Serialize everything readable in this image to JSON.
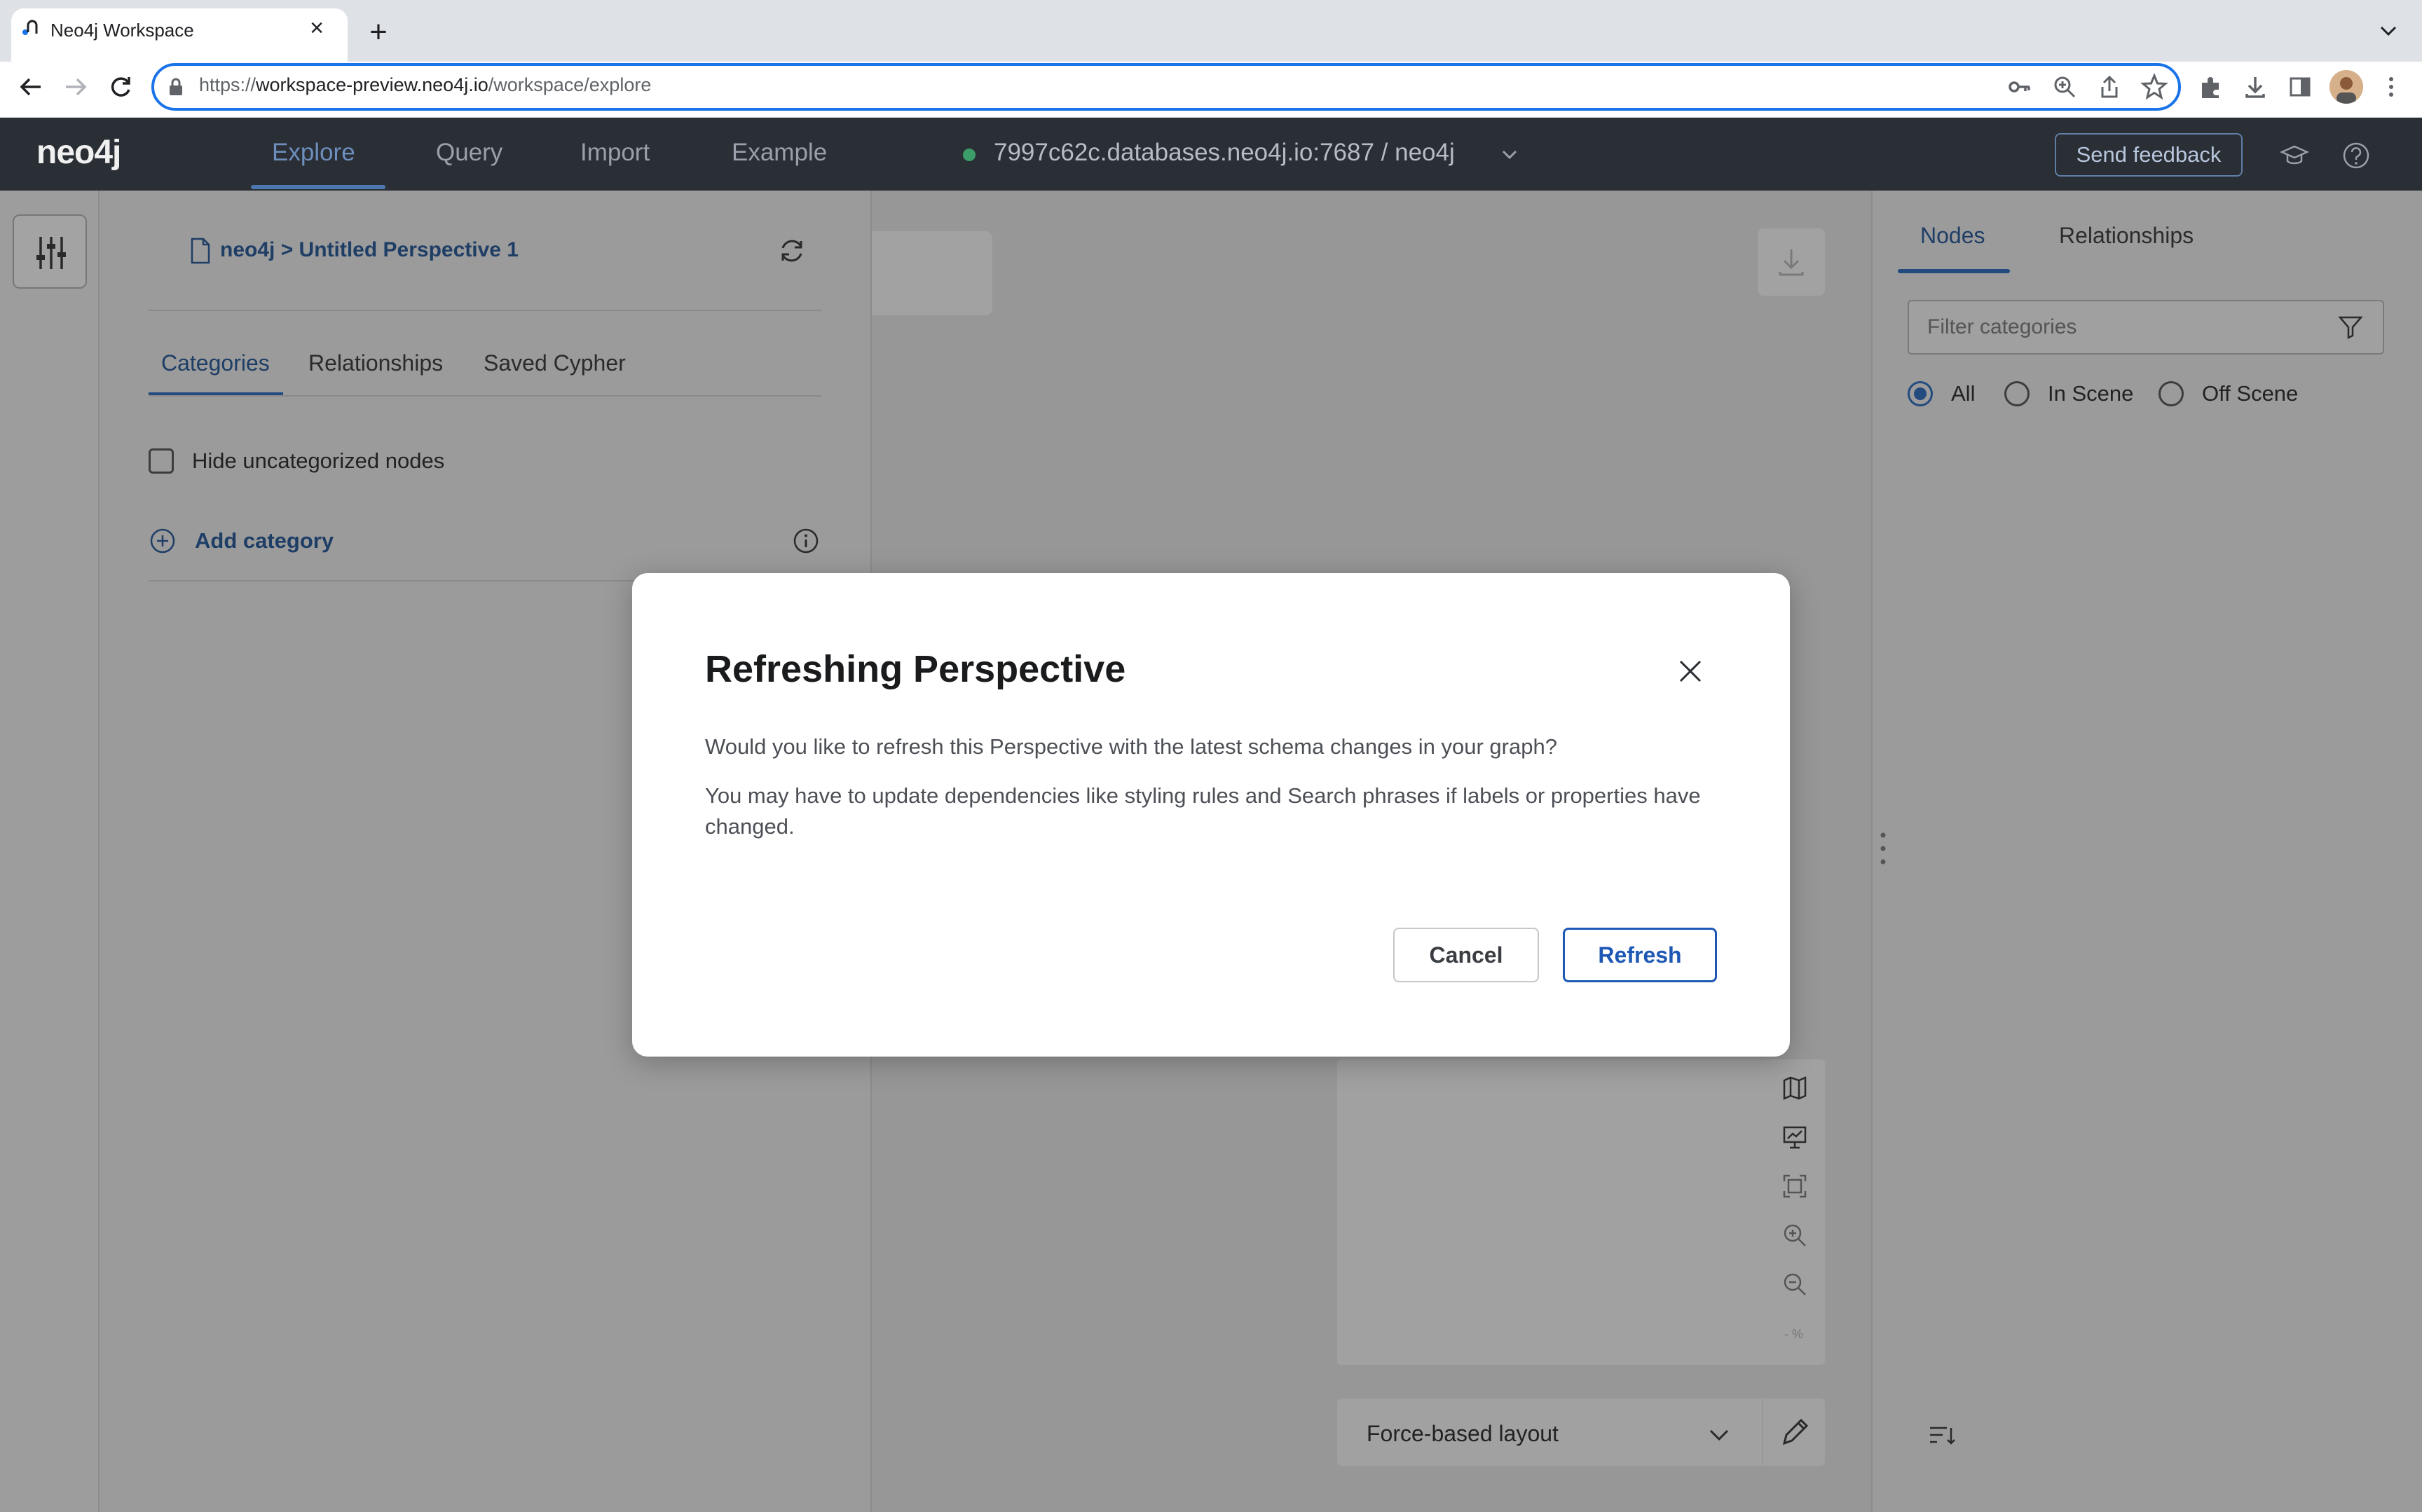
{
  "browser": {
    "tab_title": "Neo4j Workspace",
    "new_tab": "+",
    "close_tab": "×",
    "url_scheme": "https://",
    "url_host": "workspace-preview.neo4j.io",
    "url_path": "/workspace/explore"
  },
  "app": {
    "logo": "neo4j",
    "nav": [
      "Explore",
      "Query",
      "Import",
      "Example"
    ],
    "active_nav": "Explore",
    "connection": "7997c62c.databases.neo4j.io:7687 / neo4j",
    "connection_status_color": "#3b9e6a",
    "feedback_label": "Send feedback"
  },
  "left_panel": {
    "breadcrumb": "neo4j > Untitled Perspective 1",
    "tabs": [
      "Categories",
      "Relationships",
      "Saved Cypher"
    ],
    "active_tab": "Categories",
    "hide_uncategorized_label": "Hide uncategorized nodes",
    "hide_uncategorized_checked": false,
    "add_category_label": "Add category"
  },
  "canvas": {
    "layout_label": "Force-based layout",
    "zoom_pct": "- %"
  },
  "right_panel": {
    "tabs": [
      "Nodes",
      "Relationships"
    ],
    "active_tab": "Nodes",
    "filter_placeholder": "Filter categories",
    "radio_options": [
      "All",
      "In Scene",
      "Off Scene"
    ],
    "radio_selected": "All"
  },
  "modal": {
    "title": "Refreshing Perspective",
    "paragraph1": "Would you like to refresh this Perspective with the latest schema changes in your graph?",
    "paragraph2": "You may have to update dependencies like styling rules and Search phrases if labels or properties have changed.",
    "cancel_label": "Cancel",
    "refresh_label": "Refresh",
    "accent_color": "#1e58b5"
  }
}
